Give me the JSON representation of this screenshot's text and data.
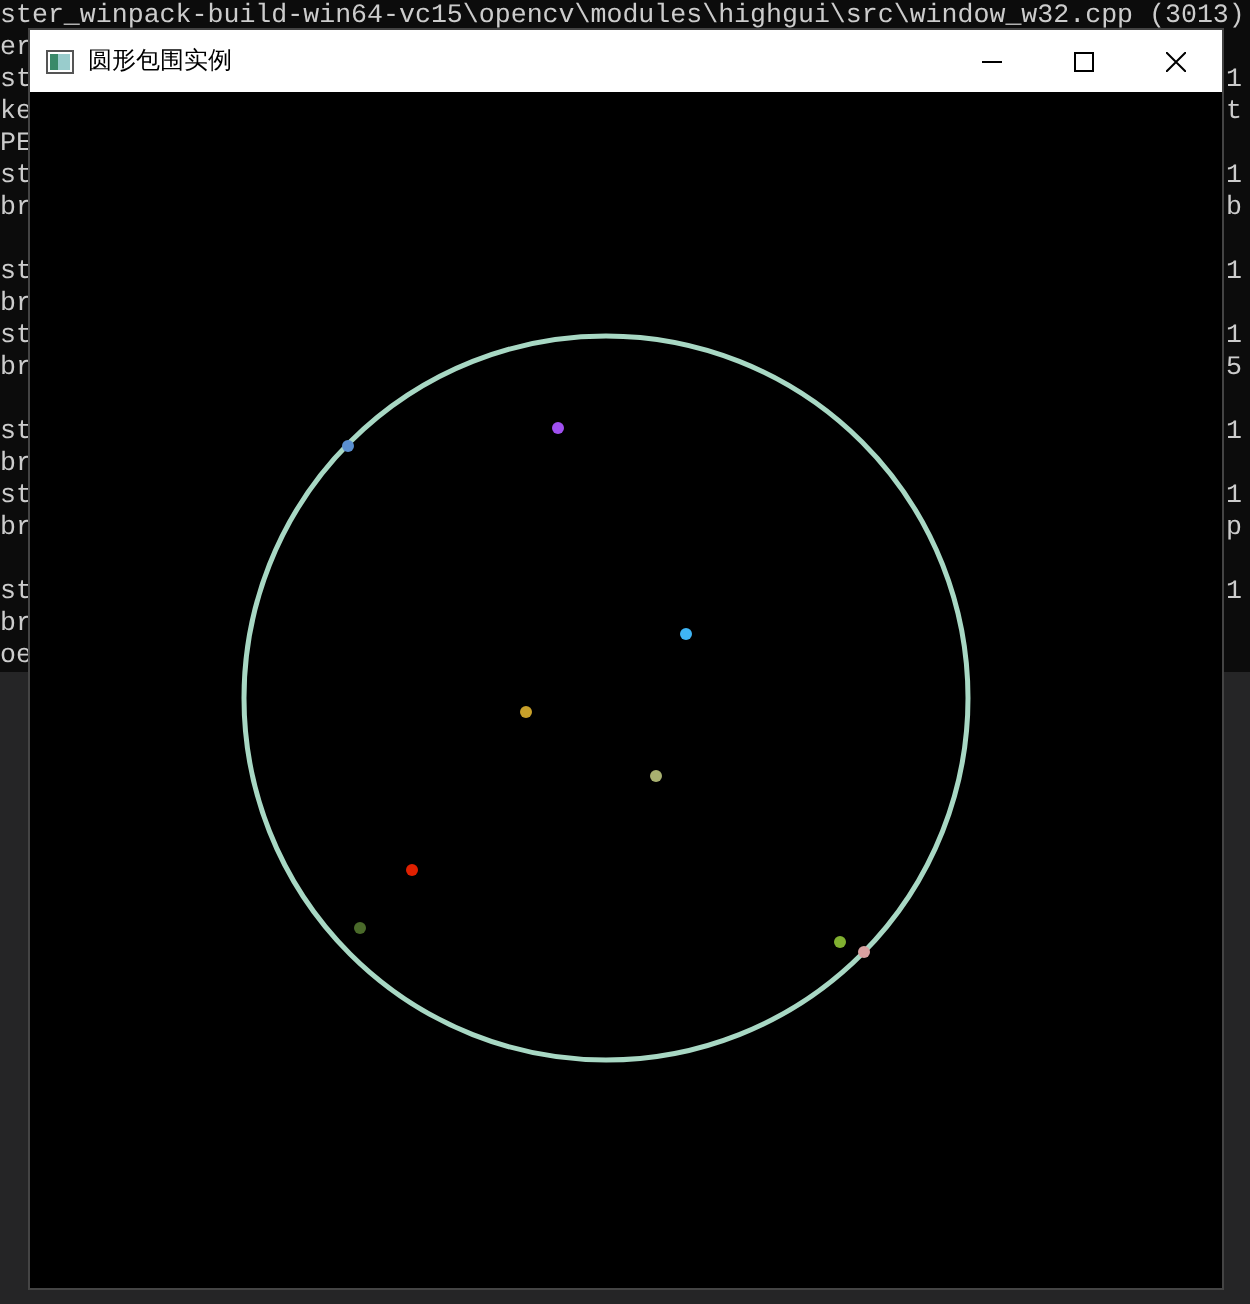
{
  "console": {
    "header": "ster_winpack-build-win64-vc15\\opencv\\modules\\highgui\\src\\window_w32.cpp (3013)",
    "blocks": [
      [
        {
          "text": "er"
        },
        {
          "text": "st",
          "tail": "1"
        },
        {
          "text": "ke",
          "tail": "t"
        },
        {
          "text": "PE"
        },
        {
          "text": "st",
          "tail": "1"
        },
        {
          "text": "br",
          "tail": "b"
        }
      ],
      [
        {
          "text": "st",
          "tail": "1"
        },
        {
          "text": "br"
        },
        {
          "text": "st",
          "tail": "1"
        },
        {
          "text": "br",
          "tail": "5"
        }
      ],
      [
        {
          "text": "st",
          "tail": "1"
        },
        {
          "text": "br"
        },
        {
          "text": "st",
          "tail": "1"
        },
        {
          "text": "br",
          "tail": "p"
        }
      ],
      [
        {
          "text": "st",
          "tail": "1"
        },
        {
          "text": "br"
        },
        {
          "text": "oe"
        }
      ]
    ]
  },
  "window": {
    "title": "圆形包围实例"
  }
}
